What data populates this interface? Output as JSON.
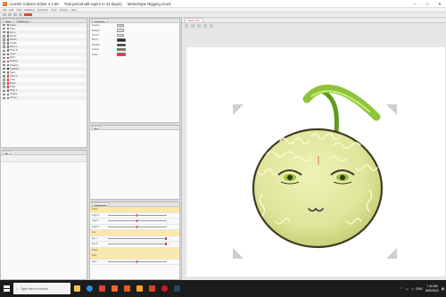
{
  "window": {
    "title": "Live2D Cubism Editor 4.1.05",
    "trial_notice": "Trial period will expire in 41 day(s)",
    "document": "Melonhope Rigging.cmo3"
  },
  "menu": [
    "File",
    "Edit",
    "View",
    "Modeling",
    "Animation",
    "Tools",
    "Window",
    "Help"
  ],
  "left_panel": {
    "tabs": [
      "Parts",
      "Deformer"
    ],
    "rows": [
      {
        "label": "Melon",
        "color": "#777"
      },
      {
        "label": "Face",
        "color": "#777"
      },
      {
        "label": "Eye L",
        "color": "#777"
      },
      {
        "label": "Eye R",
        "color": "#777"
      },
      {
        "label": "Mouth",
        "color": "#777"
      },
      {
        "label": "Cheek",
        "color": "#777"
      },
      {
        "label": "Brow L",
        "color": "#777"
      },
      {
        "label": "Brow R",
        "color": "#777"
      },
      {
        "label": "Lines",
        "color": "#777"
      },
      {
        "label": "Rind",
        "color": "#e0403a"
      },
      {
        "label": "Netting",
        "color": "#777"
      },
      {
        "label": "Shadow",
        "color": "#777"
      },
      {
        "label": "Highlight",
        "color": "#333"
      },
      {
        "label": "Stem",
        "color": "#777"
      },
      {
        "label": "Stem 2",
        "color": "#e0403a"
      },
      {
        "label": "Leaf",
        "color": "#e0403a"
      },
      {
        "label": "Base",
        "color": "#e0403a"
      },
      {
        "label": "Body",
        "color": "#e0403a"
      },
      {
        "label": "Body 2",
        "color": "#777"
      },
      {
        "label": "Outline",
        "color": "#777"
      },
      {
        "label": "Group",
        "color": "#777"
      }
    ]
  },
  "inspector": {
    "tabs": [
      "Inspector"
    ],
    "rows": [
      {
        "label": "Opacity",
        "value": "1.0"
      },
      {
        "label": "Multiply",
        "value": "1.0"
      },
      {
        "label": "Screen",
        "value": "1.0"
      },
      {
        "label": "Blend",
        "color": "#222222"
      },
      {
        "label": "Multiply",
        "color": "#222222"
      },
      {
        "label": "Screen",
        "color": "#e0403a"
      },
      {
        "label": "Order",
        "color": "#e0403a"
      }
    ]
  },
  "canvas": {
    "tab": "Melon Rig",
    "accent": "#c0392b"
  },
  "params_panel": {
    "title": "Parameter",
    "rows": [
      {
        "label": "Angle",
        "group": true,
        "knob": 0.5
      },
      {
        "label": "Angle X",
        "group": false,
        "knob": 0.5
      },
      {
        "label": "Angle Y",
        "group": false,
        "knob": 0.5
      },
      {
        "label": "Angle Z",
        "group": false,
        "knob": 0.5
      },
      {
        "label": "Eye",
        "group": true,
        "knob": 0.5
      },
      {
        "label": "Eye L",
        "group": false,
        "knob": 1.0
      },
      {
        "label": "Eye R",
        "group": false,
        "knob": 1.0
      },
      {
        "label": "Mouth",
        "group": true,
        "knob": 0.5
      },
      {
        "label": "Body",
        "group": true,
        "knob": 0.5
      },
      {
        "label": "Stem",
        "group": false,
        "knob": 0.5
      }
    ]
  },
  "taskbar": {
    "search_placeholder": "Type here to search",
    "apps": [
      "file-explorer-icon",
      "edge-icon",
      "brave-icon",
      "live2d-icon",
      "paint-icon",
      "explorer-icon",
      "office-icon",
      "opera-icon",
      "steam-icon"
    ],
    "language": "ENG",
    "time": "7:42 AM",
    "date": "5/30/2022"
  }
}
